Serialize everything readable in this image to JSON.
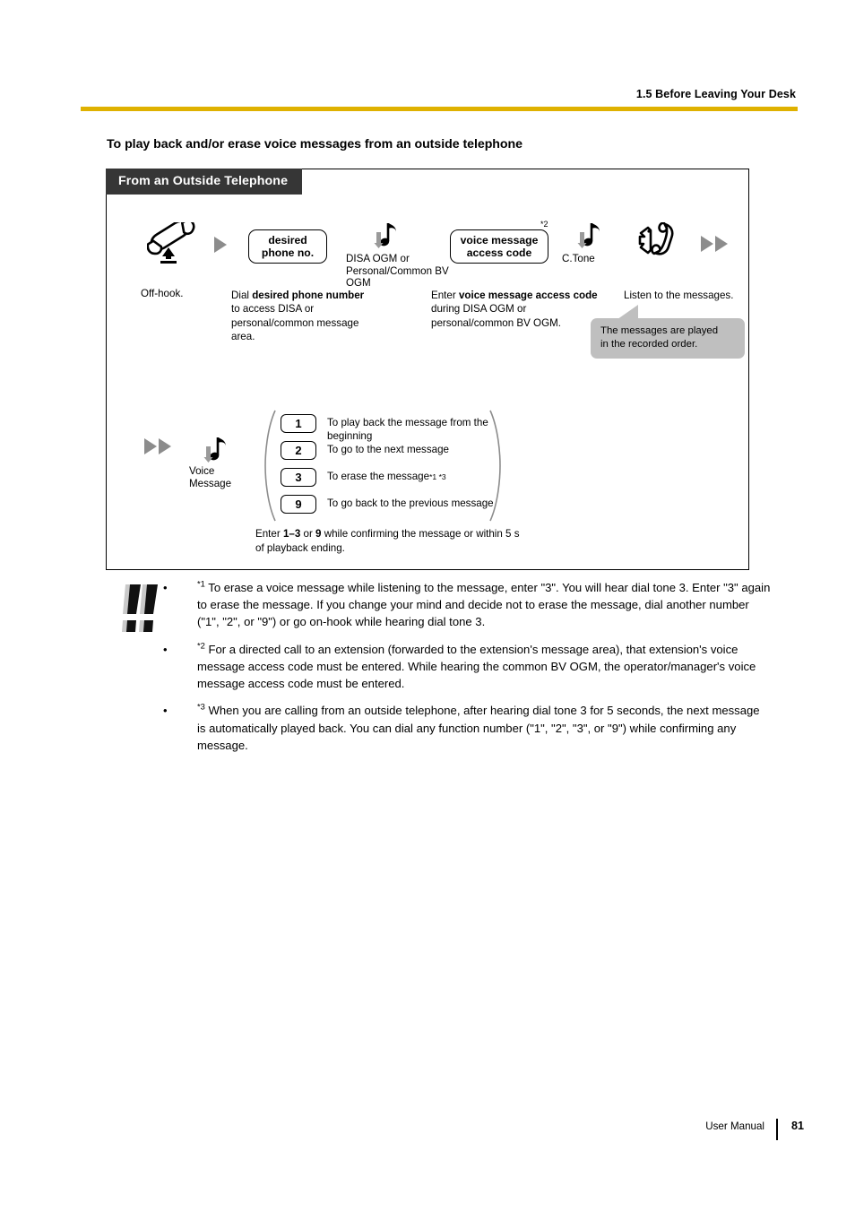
{
  "header": {
    "title": "1.5 Before Leaving Your Desk",
    "rule_color": "#dfb100"
  },
  "section": {
    "heading": "To play back and/or erase voice messages from an outside telephone"
  },
  "diagram": {
    "tab_label": "From an Outside Telephone",
    "row1": {
      "offhook_label": "Off-hook.",
      "key_desired_line1": "desired",
      "key_desired_line2": "phone no.",
      "note_disa_caption": "DISA OGM or Personal/Common BV OGM",
      "key_vmac_line1": "voice message",
      "key_vmac_line2": "access code",
      "key_vmac_superscript": "*2",
      "note_ctone_caption": "C.Tone",
      "desc_dial": "Dial desired phone number to access DISA or personal/common message area.",
      "desc_dial_bold": "desired phone number",
      "desc_vmac": "Enter voice message access code during DISA OGM or personal/common BV OGM.",
      "desc_vmac_bold": "voice message access code",
      "desc_listen": "Listen to the messages.",
      "callout_line1": "The messages are played",
      "callout_line2": "in the recorded order.",
      "callout_bg": "#bfbfbf"
    },
    "row2": {
      "note_voice_caption_line1": "Voice",
      "note_voice_caption_line2": "Message",
      "options": [
        {
          "digit": "1",
          "text": "To play back the message from the beginning",
          "refs": ""
        },
        {
          "digit": "2",
          "text": "To go to the next message",
          "refs": ""
        },
        {
          "digit": "3",
          "text": "To erase the message",
          "refs": "*1 *3"
        },
        {
          "digit": "9",
          "text": "To go back to the previous message",
          "refs": ""
        }
      ],
      "footnote_prefix": "Enter ",
      "footnote_bold1": "1–3",
      "footnote_mid": " or ",
      "footnote_bold2": "9",
      "footnote_suffix": " while confirming the message or within 5 s of playback ending."
    }
  },
  "notes": [
    {
      "marker": "*1",
      "text": " To erase a voice message while listening to the message, enter \"3\". You will hear dial tone 3. Enter \"3\" again to erase the message. If you change your mind and decide not to erase the message, dial another number (\"1\", \"2\", or \"9\") or go on-hook while hearing dial tone 3."
    },
    {
      "marker": "*2",
      "text": " For a directed call to an extension (forwarded to the extension's message area), that extension's voice message access code must be entered. While hearing the common BV OGM, the operator/manager's voice message access code must be entered."
    },
    {
      "marker": "*3",
      "text": " When you are calling from an outside telephone, after hearing dial tone 3 for 5 seconds, the next message is automatically played back. You can dial any function number (\"1\", \"2\", \"3\", or \"9\") while confirming any message."
    }
  ],
  "footer": {
    "label": "User Manual",
    "page_number": "81"
  }
}
